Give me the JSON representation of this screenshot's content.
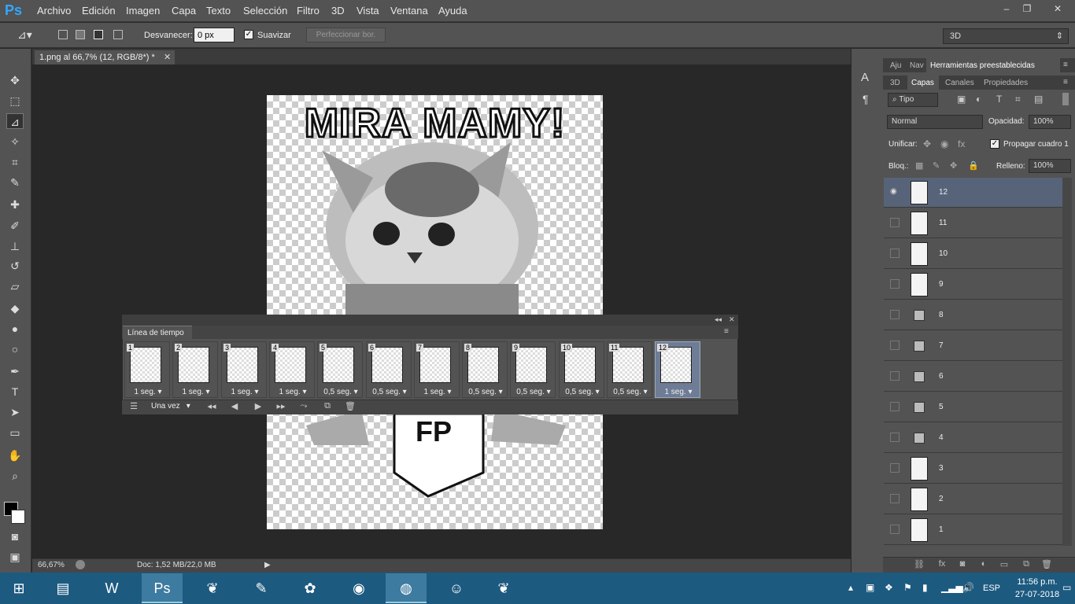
{
  "app": {
    "logo": "Ps",
    "window_controls": [
      "–",
      "❐",
      "✕"
    ]
  },
  "menu": [
    "Archivo",
    "Edición",
    "Imagen",
    "Capa",
    "Texto",
    "Selección",
    "Filtro",
    "3D",
    "Vista",
    "Ventana",
    "Ayuda"
  ],
  "options": {
    "feather_label": "Desvanecer:",
    "feather_value": "0 px",
    "smooth_label": "Suavizar",
    "smooth_checked": true,
    "refine_label": "Perfeccionar bor.",
    "workspace": "3D"
  },
  "document": {
    "tab_title": "1.png al 66,7% (12, RGB/8*) *",
    "canvas_title": "MIRA MAMY!",
    "zoom": "66,67%",
    "doc_info": "Doc: 1,52 MB/22,0 MB"
  },
  "timeline": {
    "title": "Línea de tiempo",
    "loop": "Una vez",
    "frames": [
      {
        "num": "1",
        "delay": "1 seg."
      },
      {
        "num": "2",
        "delay": "1 seg."
      },
      {
        "num": "3",
        "delay": "1 seg."
      },
      {
        "num": "4",
        "delay": "1 seg."
      },
      {
        "num": "5",
        "delay": "0,5 seg."
      },
      {
        "num": "6",
        "delay": "0,5 seg."
      },
      {
        "num": "7",
        "delay": "1 seg."
      },
      {
        "num": "8",
        "delay": "0,5 seg."
      },
      {
        "num": "9",
        "delay": "0,5 seg."
      },
      {
        "num": "10",
        "delay": "0,5 seg."
      },
      {
        "num": "11",
        "delay": "0,5 seg."
      },
      {
        "num": "12",
        "delay": "1 seg."
      }
    ],
    "selected_frame": "12"
  },
  "panels": {
    "tabs_top": [
      "Aju",
      "Nav",
      "Herramientas preestablecidas"
    ],
    "tabs_layers": [
      "3D",
      "Capas",
      "Canales",
      "Propiedades"
    ],
    "filter_kind": "Tipo",
    "blend_mode": "Normal",
    "opacity_label": "Opacidad:",
    "opacity_value": "100%",
    "unify_label": "Unificar:",
    "propagate_label": "Propagar cuadro 1",
    "lock_label": "Bloq.:",
    "fill_label": "Relleno:",
    "fill_value": "100%"
  },
  "layers": [
    "12",
    "11",
    "10",
    "9",
    "8",
    "7",
    "6",
    "5",
    "4",
    "3",
    "2",
    "1"
  ],
  "taskbar": {
    "lang": "ESP",
    "time": "11:56 p.m.",
    "date": "27-07-2018"
  }
}
